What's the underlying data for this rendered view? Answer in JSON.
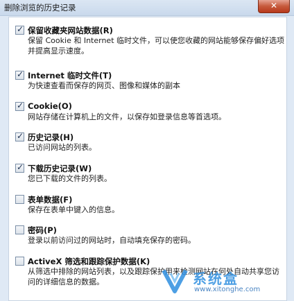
{
  "window": {
    "title": "删除浏览的历史记录",
    "close_glyph": "✕"
  },
  "options": [
    {
      "label": "保留收藏夹网站数据(R)",
      "checked": true,
      "description": "保留 Cookie 和 Internet 临时文件，可以使您收藏的网站能够保存偏好选项并提高显示速度。"
    },
    {
      "label": "Internet 临时文件(T)",
      "checked": true,
      "description": "为快速查看而保存的网页、图像和媒体的副本"
    },
    {
      "label": "Cookie(O)",
      "checked": true,
      "description": "网站存储在计算机上的文件，以保存如登录信息等首选项。"
    },
    {
      "label": "历史记录(H)",
      "checked": true,
      "description": "已访问网站的列表。"
    },
    {
      "label": "下载历史记录(W)",
      "checked": true,
      "description": "您已下载的文件的列表。"
    },
    {
      "label": "表单数据(F)",
      "checked": false,
      "description": "保存在表单中键入的信息。"
    },
    {
      "label": "密码(P)",
      "checked": false,
      "description": "登录以前访问过的网站时，自动填充保存的密码。"
    },
    {
      "label": "ActiveX 筛选和跟踪保护数据(K)",
      "checked": false,
      "description": "从筛选中排除的网站列表，以及跟踪保护用来检测网站在何处自动共享您访问的详细信息的数据。"
    }
  ],
  "watermark": {
    "brand": "系统盒",
    "url": "www.xitonghe.com"
  },
  "colors": {
    "accent": "#2f8fe0",
    "close_button": "#c65a3c"
  },
  "icons": {
    "check": "checkmark-icon",
    "close": "close-icon",
    "watermark_logo": "xitonghe-logo-icon"
  }
}
